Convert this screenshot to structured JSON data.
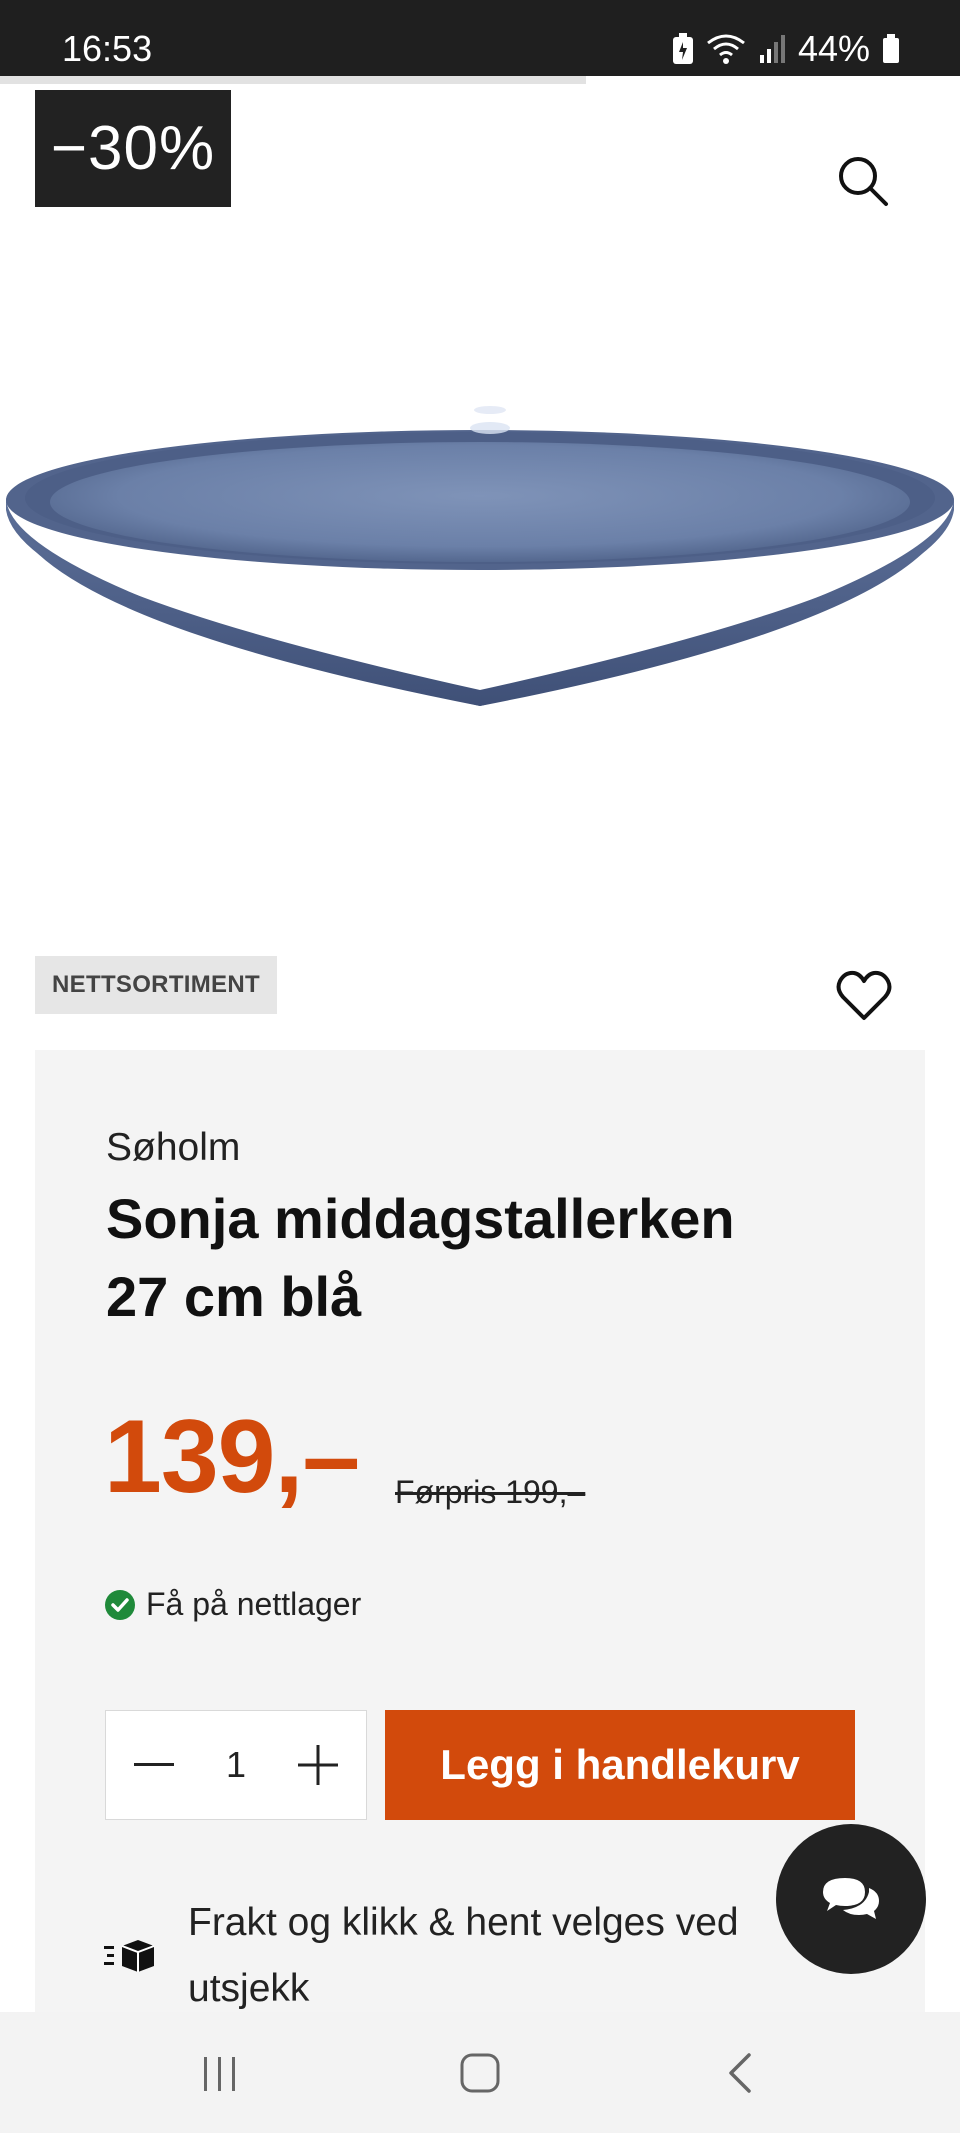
{
  "status_bar": {
    "time": "16:53",
    "battery": "44%"
  },
  "loading_progress": 0.61,
  "product": {
    "discount": "−30%",
    "tag": "NETTSORTIMENT",
    "brand": "Søholm",
    "title": "Sonja middagstallerken 27 cm blå",
    "price": "139,–",
    "old_price": "Førpris 199,–",
    "stock": "Få på nettlager",
    "image_icon": "plate-image",
    "colors": {
      "accent": "#d24a0c",
      "plate": "#5a6d96"
    }
  },
  "cart": {
    "quantity": "1",
    "add_label": "Legg i handlekurv"
  },
  "shipping": {
    "text": "Frakt og klikk & hent velges ved utsjekk"
  },
  "icons": {
    "search": "search-icon",
    "favorite": "heart-icon",
    "stock": "check-circle-icon",
    "minus": "minus-icon",
    "plus": "plus-icon",
    "shipping": "delivery-box-icon",
    "chat": "chat-bubbles-icon"
  }
}
